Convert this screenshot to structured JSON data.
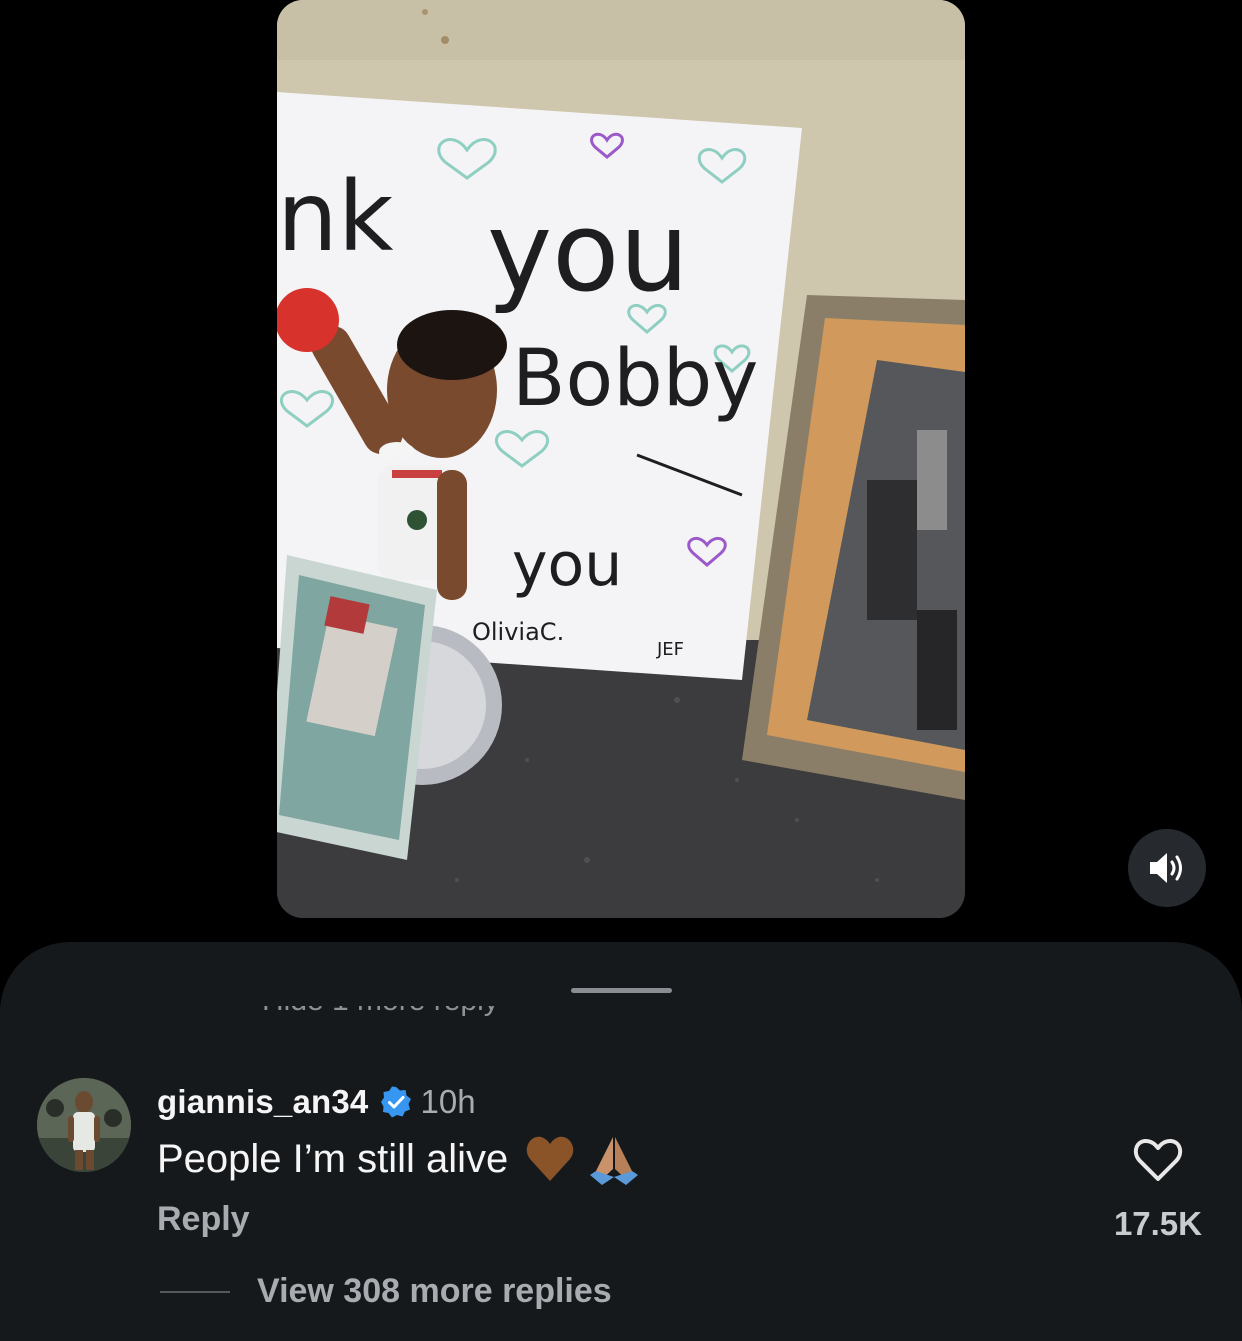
{
  "video": {
    "sign_lines": [
      "nk",
      "you",
      "Bobby",
      "you"
    ],
    "sign_signatures": [
      "OliviaC.",
      "JEF"
    ],
    "mute_icon": "speaker-volume-icon"
  },
  "sheet": {
    "cutoff_text": "Hide 1 more reply"
  },
  "comment": {
    "username": "giannis_an34",
    "verified_icon": "verified-badge-icon",
    "time": "10h",
    "text": "People I’m still alive",
    "emojis": [
      "brown-heart-emoji",
      "folded-hands-emoji"
    ],
    "reply_label": "Reply",
    "like_icon": "heart-outline-icon",
    "like_count": "17.5K",
    "view_replies": "View 308 more replies"
  },
  "colors": {
    "background": "#000000",
    "sheet": "#16191c",
    "verified": "#3797f0",
    "secondary_text": "#a8abaf"
  }
}
